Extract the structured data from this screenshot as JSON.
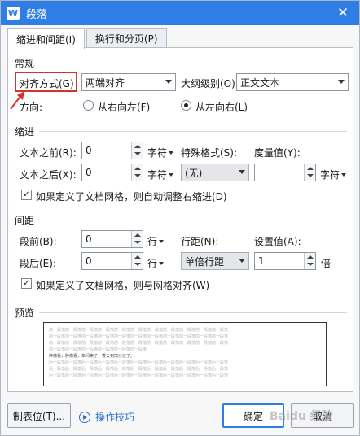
{
  "window": {
    "title": "段落",
    "app_icon_letter": "W"
  },
  "tabs": [
    {
      "label": "缩进和间距(I)",
      "active": true
    },
    {
      "label": "换行和分页(P)",
      "active": false
    }
  ],
  "general": {
    "section": "常规",
    "alignment_label": "对齐方式(G)",
    "alignment_value": "两端对齐",
    "outline_label": "大纲级别(O):",
    "outline_value": "正文文本",
    "direction_label": "方向:",
    "rtl_label": "从右向左(F)",
    "ltr_label": "从左向右(L)",
    "direction_selected": "ltr"
  },
  "indent": {
    "section": "缩进",
    "before_label": "文本之前(R):",
    "before_value": "0",
    "before_unit": "字符",
    "after_label": "文本之后(X):",
    "after_value": "0",
    "after_unit": "字符",
    "special_label": "特殊格式(S):",
    "special_value": "(无)",
    "measure_label": "度量值(Y):",
    "measure_value": "",
    "measure_unit": "字符",
    "auto_adjust_label": "如果定义了文档网格，则自动调整右缩进(D)",
    "auto_adjust_checked": true
  },
  "spacing": {
    "section": "间距",
    "before_label": "段前(B):",
    "before_value": "0",
    "before_unit": "行",
    "after_label": "段后(E):",
    "after_value": "0",
    "after_unit": "行",
    "line_label": "行距(N):",
    "line_value": "单倍行距",
    "setting_label": "设置值(A):",
    "setting_value": "1",
    "setting_unit": "倍",
    "snap_grid_label": "如果定义了文档网格，则与网格对齐(W)",
    "snap_grid_checked": true
  },
  "preview": {
    "section": "预览",
    "prev_lines": [
      "前一段落前一段落前一段落前一段落前一段落前一段落前一段落前一段落前一段落前一段落前一段落",
      "前一段落前一段落前一段落前一段落前一段落前一段落前一段落前一段落前一段落前一段落前一段落",
      "前一段落前一段落前一段落前一段落前一段落前一段落前一段落前一段落前一段落前一段落前一段落",
      "前一段落前一段落前一段落前一段落前一段落前一段落"
    ],
    "sample_line": "肿瘤看，肿瘤看，车间来了，香天到加沙过了。",
    "next_lines": [
      "后一段落后一段落后一段落后一段落后一段落后一段落后一段落后一段落后一段落后一段落后一段落",
      "后一段落后一段落后一段落后一段落后一段落后一段落后一段落后一段落后一段落后一段落后一段落",
      "后一段落后一段落后一段落后一段落后一段落后一段落后一段落后一段落后一段落后一段落后一段落"
    ]
  },
  "footer": {
    "tabs_button": "制表位(T)...",
    "tips_link": "操作技巧",
    "ok_button": "确定",
    "cancel_button": "取消"
  },
  "watermark_text": "Baidu 经验",
  "colors": {
    "titlebar": "#2f7ee6",
    "highlight": "#d8302b",
    "link": "#2f6fc9"
  }
}
